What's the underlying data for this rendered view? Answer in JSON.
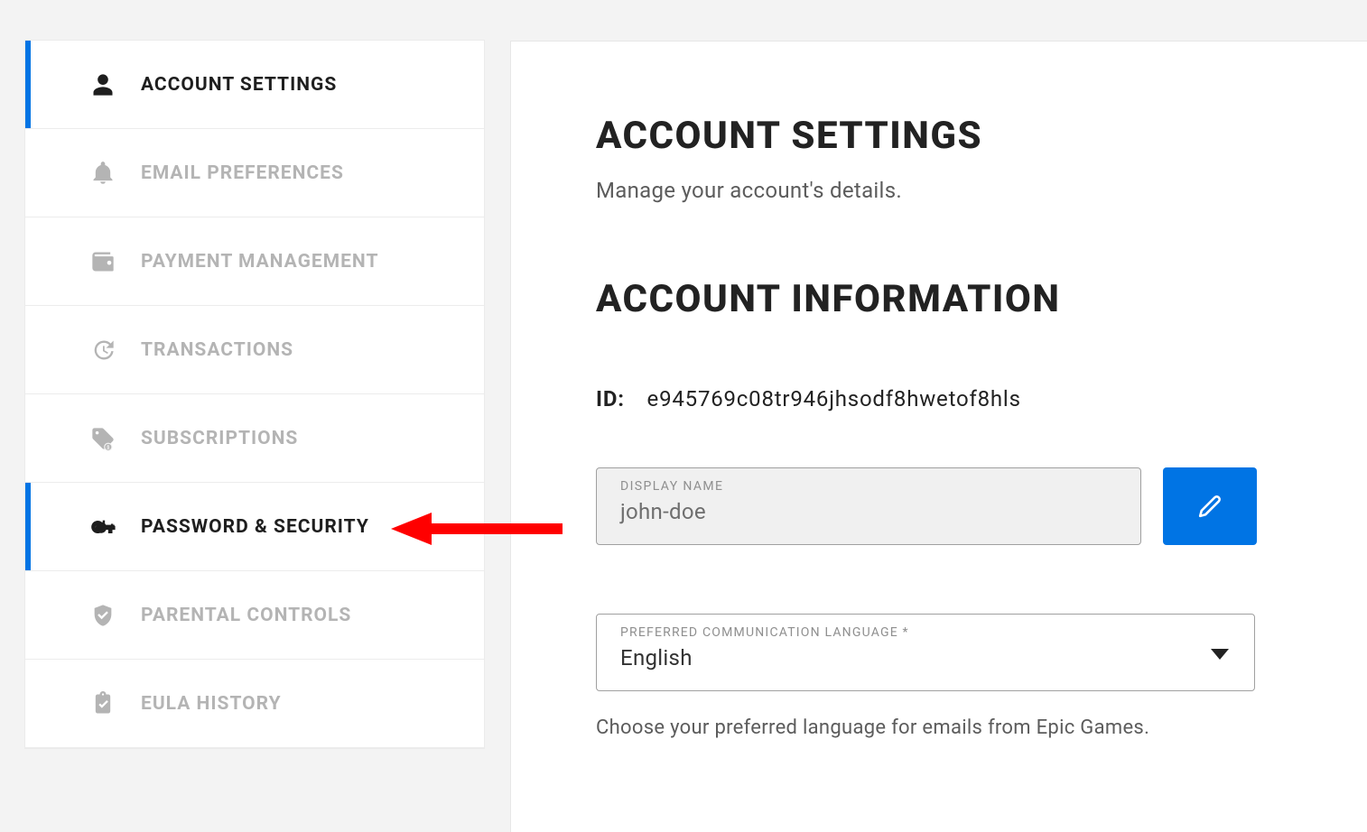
{
  "sidebar": {
    "items": [
      {
        "label": "ACCOUNT SETTINGS"
      },
      {
        "label": "EMAIL PREFERENCES"
      },
      {
        "label": "PAYMENT MANAGEMENT"
      },
      {
        "label": "TRANSACTIONS"
      },
      {
        "label": "SUBSCRIPTIONS"
      },
      {
        "label": "PASSWORD & SECURITY"
      },
      {
        "label": "PARENTAL CONTROLS"
      },
      {
        "label": "EULA HISTORY"
      }
    ]
  },
  "main": {
    "title": "ACCOUNT SETTINGS",
    "subtitle": "Manage your account's details.",
    "section": "ACCOUNT INFORMATION",
    "id_label": "ID:",
    "id_value": "e945769c08tr946jhsodf8hwetof8hls",
    "display_name": {
      "label": "DISPLAY NAME",
      "value": "john-doe"
    },
    "language": {
      "label": "PREFERRED COMMUNICATION LANGUAGE *",
      "value": "English"
    },
    "language_help": "Choose your preferred language for emails from Epic Games."
  },
  "colors": {
    "accent": "#0074E4",
    "annotation": "#FF0000"
  }
}
